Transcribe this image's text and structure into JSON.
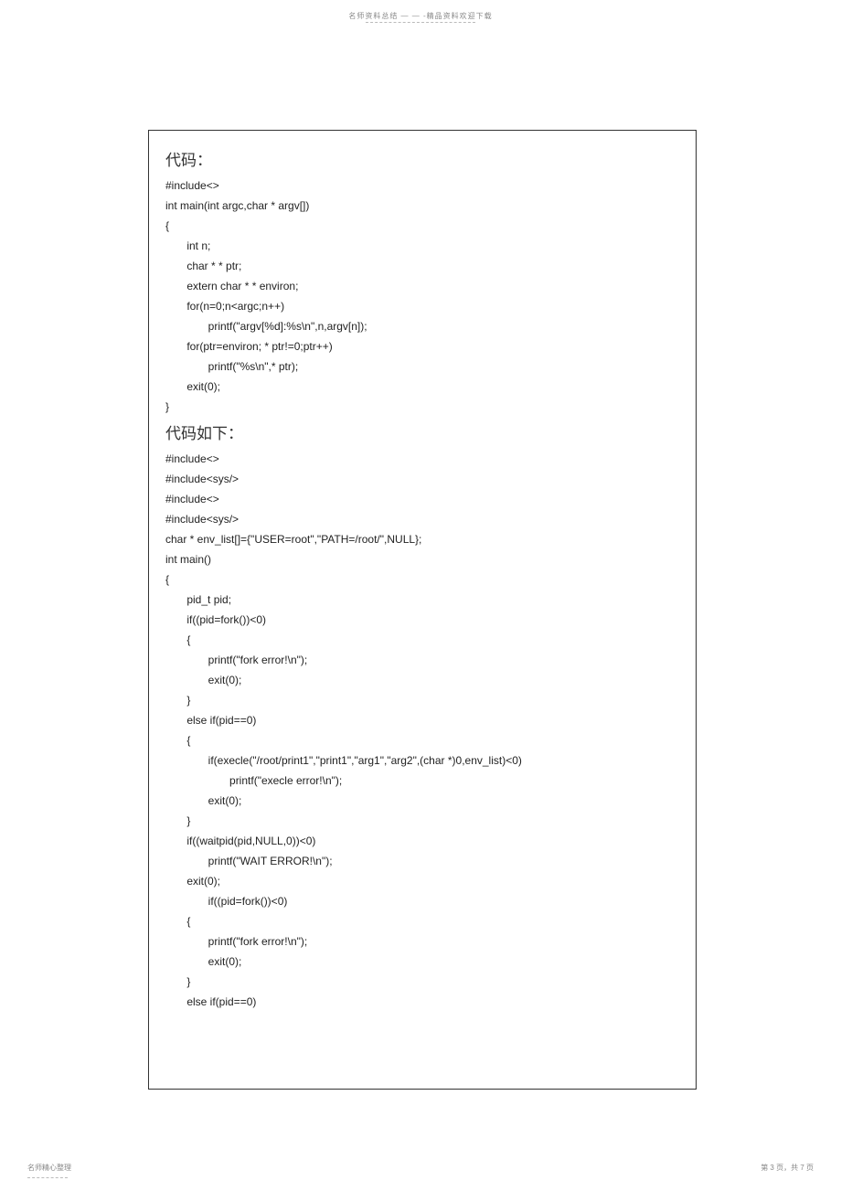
{
  "header": {
    "text": "名师资料总结 — — -精品资料欢迎下载"
  },
  "section1": {
    "title": "代码：",
    "code": "#include<>\nint main(int argc,char * argv[])\n{\n       int n;\n       char * * ptr;\n       extern char * * environ;\n       for(n=0;n<argc;n++)\n              printf(\"argv[%d]:%s\\n\",n,argv[n]);\n       for(ptr=environ; * ptr!=0;ptr++)\n              printf(\"%s\\n\",* ptr);\n       exit(0);\n}"
  },
  "section2": {
    "title": "代码如下：",
    "code": "#include<>\n#include<sys/>\n#include<>\n#include<sys/>\nchar * env_list[]={\"USER=root\",\"PATH=/root/\",NULL};\nint main()\n{\n       pid_t pid;\n       if((pid=fork())<0)\n       {\n              printf(\"fork error!\\n\");\n              exit(0);\n       }\n       else if(pid==0)\n       {\n              if(execle(\"/root/print1\",\"print1\",\"arg1\",\"arg2\",(char *)0,env_list)<0)\n                     printf(\"execle error!\\n\");\n              exit(0);\n       }\n       if((waitpid(pid,NULL,0))<0)\n              printf(\"WAIT ERROR!\\n\");\n       exit(0);\n              if((pid=fork())<0)\n       {\n              printf(\"fork error!\\n\");\n              exit(0);\n       }\n       else if(pid==0)"
  },
  "footer": {
    "left": "名师精心整理",
    "right": "第 3 页，共 7 页"
  }
}
